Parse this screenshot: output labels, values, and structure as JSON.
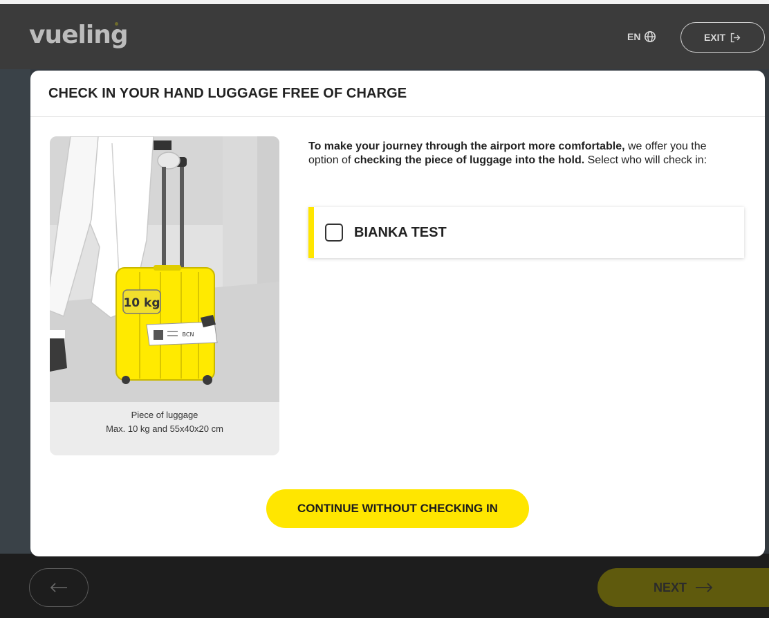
{
  "header": {
    "logo_text": "vueling",
    "language": "EN",
    "exit_label": "EXIT"
  },
  "modal": {
    "title": "CHECK IN YOUR HAND LUGGAGE FREE OF CHARGE",
    "description": {
      "part1_bold": "To make your journey through the airport more comfortable,",
      "part2": " we offer you the option of ",
      "part3_bold": "checking the piece of luggage into the hold.",
      "part4": " Select who will check in:"
    },
    "luggage_card": {
      "weight_tag": "10 kg",
      "tag_code": "BCN",
      "caption_line1": "Piece of luggage",
      "caption_line2": "Max. 10 kg and 55x40x20 cm"
    },
    "passengers": [
      {
        "name": "BIANKA TEST",
        "checked": false
      }
    ],
    "continue_label": "CONTINUE WITHOUT CHECKING IN"
  },
  "footer": {
    "next_label": "NEXT"
  },
  "colors": {
    "brand_yellow": "#ffe600",
    "next_disabled": "#5f5a0d"
  }
}
